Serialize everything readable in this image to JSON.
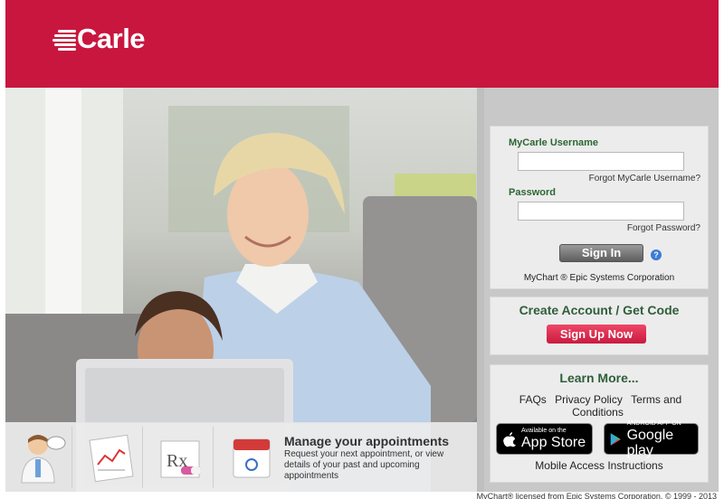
{
  "brand": {
    "name": "Carle",
    "color": "#c8163f"
  },
  "login": {
    "username_label": "MyCarle Username",
    "username_value": "",
    "forgot_username": "Forgot MyCarle Username?",
    "password_label": "Password",
    "password_value": "",
    "forgot_password": "Forgot Password?",
    "signin_label": "Sign In",
    "help_glyph": "?",
    "credit": "MyChart ® Epic Systems Corporation"
  },
  "create": {
    "title": "Create Account / Get Code",
    "signup_label": "Sign Up Now"
  },
  "learn": {
    "title": "Learn More...",
    "links": [
      "FAQs",
      "Privacy Policy",
      "Terms and Conditions"
    ],
    "app_store": {
      "small": "Available on the",
      "big": "App Store"
    },
    "google_play": {
      "small": "ANDROID APP ON",
      "big": "Google play"
    },
    "mobile_instructions": "Mobile Access Instructions"
  },
  "promo": {
    "title": "Manage your appointments",
    "description": "Request your next appointment, or view details of your past and upcoming appointments",
    "icons": [
      "doctor-icon",
      "lab-results-icon",
      "prescription-icon",
      "calendar-icon"
    ]
  },
  "footer": {
    "text": "MyChart® licensed from Epic Systems Corporation, © 1999 - 2013"
  }
}
